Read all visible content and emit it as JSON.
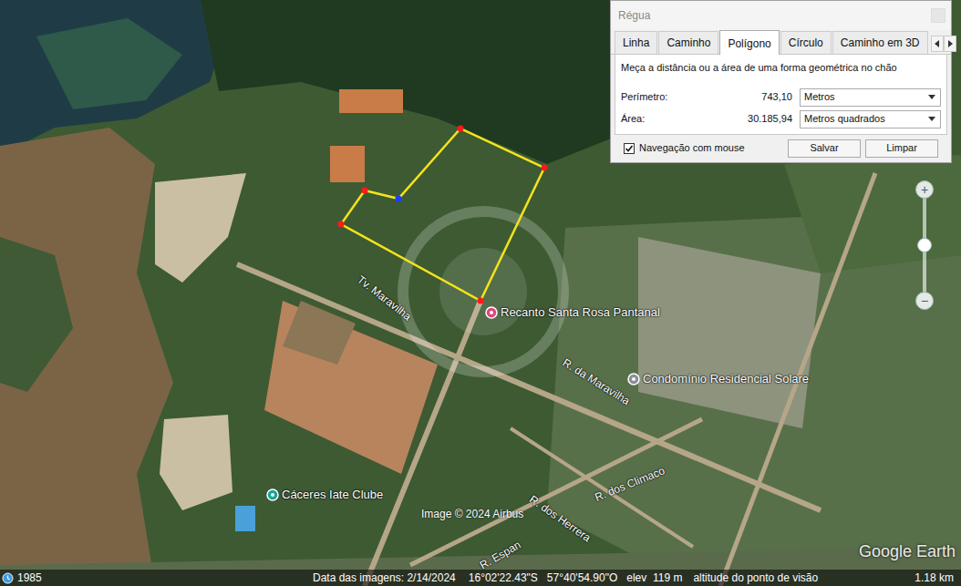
{
  "dialog": {
    "title": "Régua",
    "tabs": [
      {
        "label": "Linha",
        "selected": false
      },
      {
        "label": "Caminho",
        "selected": false
      },
      {
        "label": "Polígono",
        "selected": true
      },
      {
        "label": "Círculo",
        "selected": false
      },
      {
        "label": "Caminho em 3D",
        "selected": false
      }
    ],
    "description": "Meça a distância ou a área de uma forma geométrica no chão",
    "measures": [
      {
        "label": "Perímetro:",
        "value": "743,10",
        "unit": "Metros"
      },
      {
        "label": "Área:",
        "value": "30.185,94",
        "unit": "Metros quadrados"
      }
    ],
    "mouse_navigation": {
      "label": "Navegação com mouse",
      "checked": true
    },
    "buttons": [
      "Salvar",
      "Limpar"
    ]
  },
  "map": {
    "places": [
      {
        "name": "Recanto Santa Rosa Pantanal",
        "color": "#e0457b"
      },
      {
        "name": "Condomínio Residencial Solare",
        "color": "#8a8f98"
      },
      {
        "name": "Cáceres Iate Clube",
        "color": "#1aa39a"
      }
    ],
    "streets": [
      "Tv. Maravilha",
      "R. da Maravilha",
      "R. dos Climaco",
      "R. dos Herrera",
      "R. Espan"
    ],
    "credit": "Image © 2024 Airbus",
    "logo": "Google Earth",
    "polygon": {
      "vertices": [
        {
          "selected": false
        },
        {
          "selected": false
        },
        {
          "selected": false
        },
        {
          "selected": false
        },
        {
          "selected": false
        },
        {
          "selected": true
        }
      ]
    }
  },
  "zoom": {
    "plus": "+",
    "minus": "−",
    "level": 0.5
  },
  "status_bar": {
    "year": "1985",
    "date": "Data das imagens: 2/14/2024",
    "latitude": "16°02'22.43\"S",
    "longitude": "57°40'54.90\"O",
    "elevation": "elev  119 m",
    "eye_label": "altitude do ponto de visão",
    "eye_altitude": "1.18 km"
  }
}
